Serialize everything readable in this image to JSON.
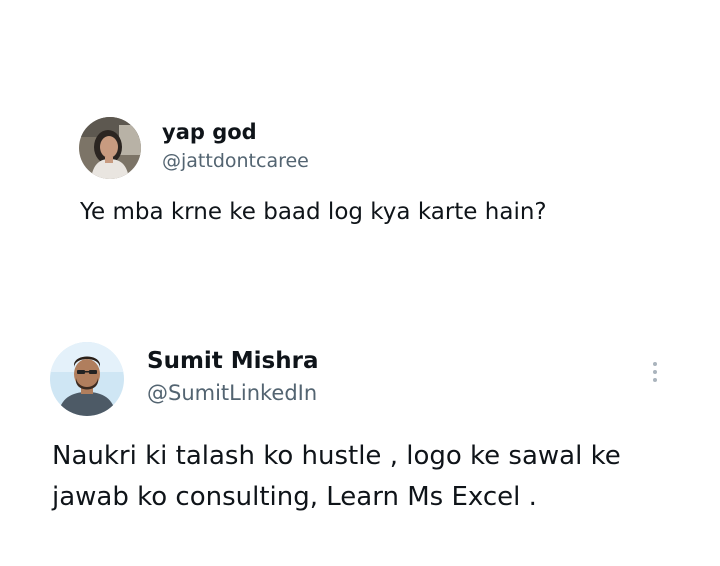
{
  "tweets": [
    {
      "display_name": "yap god",
      "handle": "@jattdontcaree",
      "text": "Ye mba krne ke baad log kya karte hain?",
      "avatar_icon": "profile-photo-woman"
    },
    {
      "display_name": "Sumit Mishra",
      "handle": "@SumitLinkedIn",
      "text": "Naukri ki talash ko hustle , logo ke sawal ke jawab ko consulting, Learn Ms Excel .",
      "avatar_icon": "profile-photo-man",
      "more_icon": "vertical-ellipsis-icon"
    }
  ],
  "colors": {
    "name_text": "#0f1419",
    "handle_text": "#536471",
    "more_dots": "#aab4bd"
  }
}
